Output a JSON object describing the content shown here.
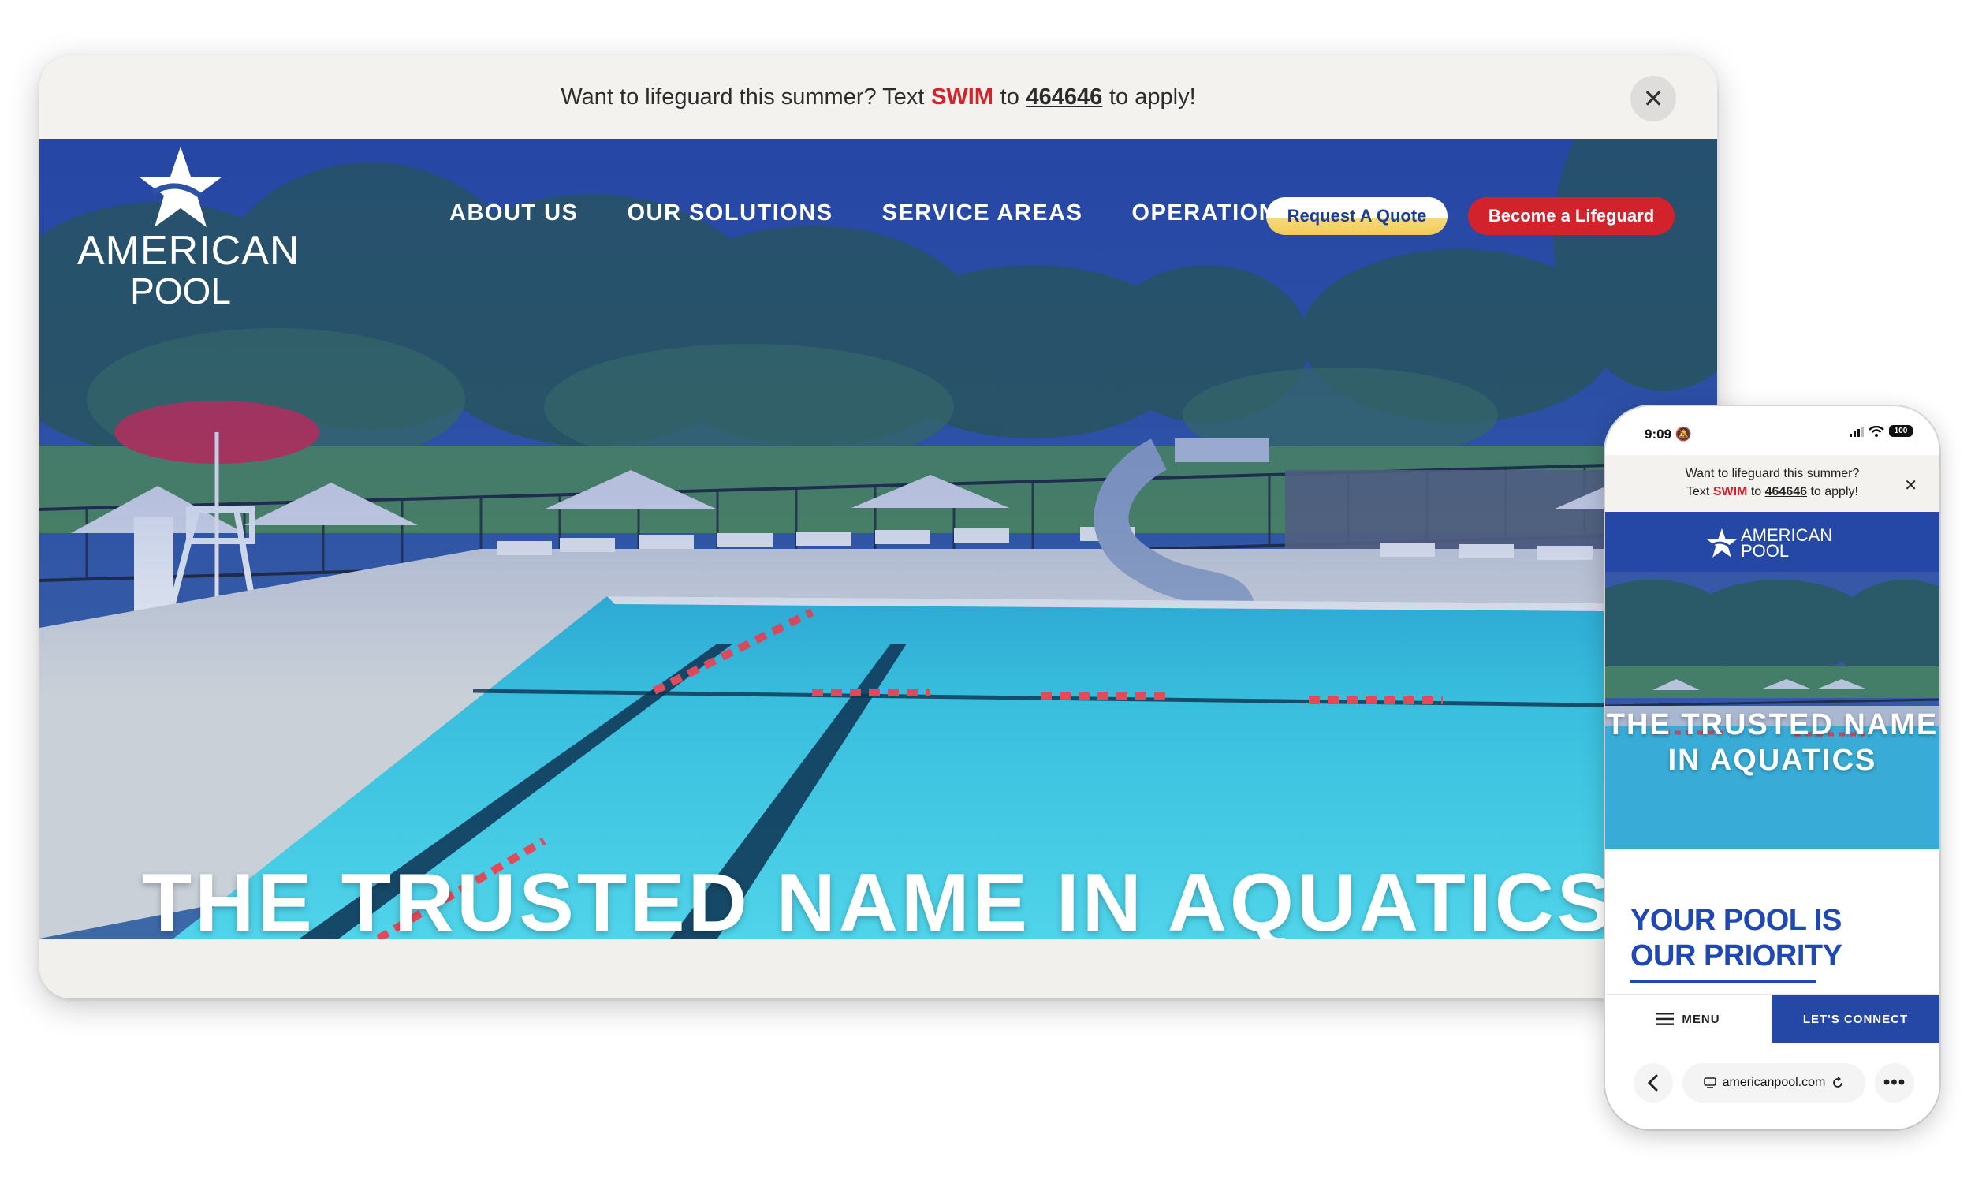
{
  "announcement": {
    "prefix": "Want to lifeguard this summer? Text",
    "keyword": "SWIM",
    "middle": "to",
    "number": "464646",
    "suffix": "to apply!"
  },
  "logo": {
    "line1": "AMERICAN",
    "line2": "POOL"
  },
  "nav": {
    "items": [
      "ABOUT US",
      "OUR SOLUTIONS",
      "SERVICE AREAS",
      "OPERATIONS"
    ],
    "quote_button": "Request A Quote",
    "lifeguard_button": "Become a Lifeguard"
  },
  "hero": {
    "title": "THE TRUSTED NAME IN AQUATICS"
  },
  "mobile": {
    "time": "9:09",
    "battery": "100",
    "announcement": {
      "line1": "Want to lifeguard this summer?",
      "text_word": "Text",
      "keyword": "SWIM",
      "middle": "to",
      "number": "464646",
      "suffix": "to apply!"
    },
    "logo": {
      "line1": "AMERICAN",
      "line2": "POOL"
    },
    "hero_title": "THE TRUSTED NAME IN AQUATICS",
    "section_title": "YOUR POOL IS OUR PRIORITY",
    "menu_label": "MENU",
    "connect_label": "LET'S CONNECT",
    "url": "americanpool.com"
  },
  "colors": {
    "brand_blue": "#2547a5",
    "accent_red": "#d2232c",
    "accent_yellow": "#f2cc58",
    "heading_blue": "#1f47b5"
  },
  "icons": [
    "close-icon",
    "star-logo-icon",
    "chevron-down-icon",
    "hamburger-icon",
    "back-arrow-icon",
    "reload-icon",
    "more-icon",
    "wifi-icon",
    "signal-icon",
    "battery-icon",
    "mute-icon",
    "tabs-icon"
  ]
}
